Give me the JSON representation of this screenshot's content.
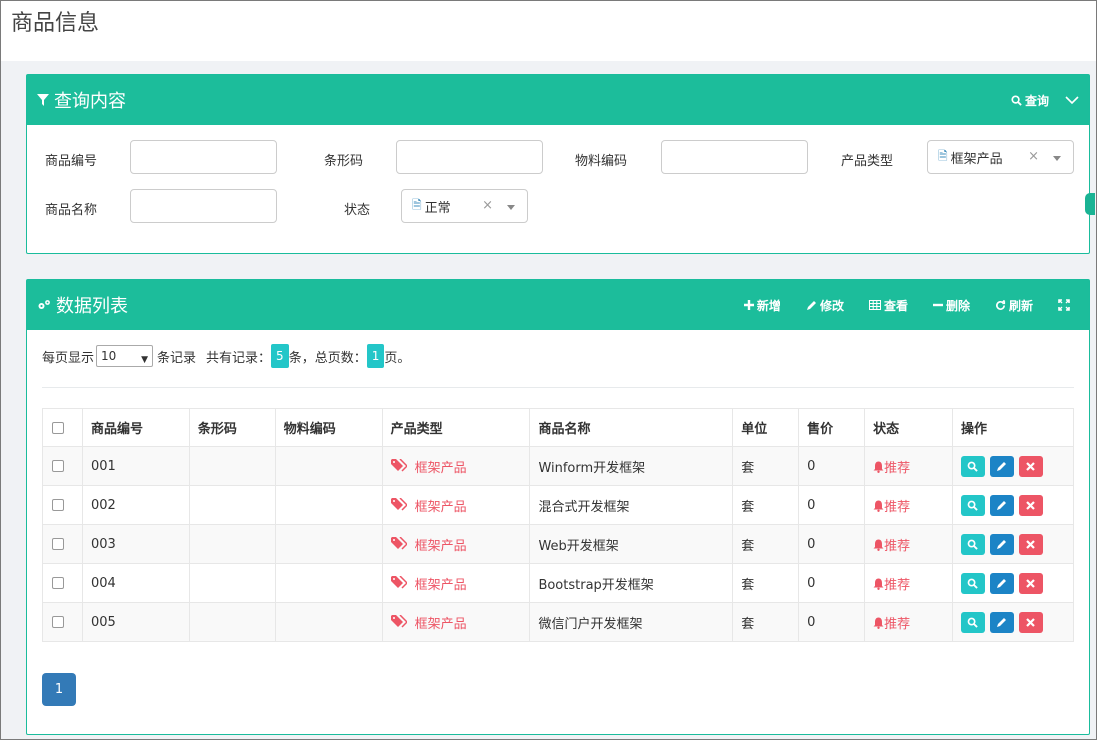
{
  "page": {
    "title": "商品信息"
  },
  "query": {
    "title": "查询内容",
    "search_label": "查询",
    "fields": {
      "product_code": "商品编号",
      "barcode": "条形码",
      "material_code": "物料编码",
      "product_type": "产品类型",
      "product_name": "商品名称",
      "status": "状态"
    },
    "product_type_value": "框架产品",
    "status_value": "正常",
    "clear_glyph": "×"
  },
  "datalist": {
    "title": "数据列表",
    "toolbar": {
      "add": "新增",
      "edit": "修改",
      "view": "查看",
      "delete": "删除",
      "refresh": "刷新"
    },
    "pager": {
      "per_page_prefix": "每页显示",
      "page_size": "10",
      "records_suffix": "条记录",
      "total_prefix": "共有记录：",
      "total": "5",
      "total_suffix": "条，总页数：",
      "pages": "1",
      "pages_suffix": "页。",
      "current_page": "1"
    },
    "columns": [
      "商品编号",
      "条形码",
      "物料编码",
      "产品类型",
      "商品名称",
      "单位",
      "售价",
      "状态",
      "操作"
    ],
    "rows": [
      {
        "code": "001",
        "barcode": "",
        "material": "",
        "type": "框架产品",
        "name": "Winform开发框架",
        "unit": "套",
        "price": "0",
        "status": "推荐"
      },
      {
        "code": "002",
        "barcode": "",
        "material": "",
        "type": "框架产品",
        "name": "混合式开发框架",
        "unit": "套",
        "price": "0",
        "status": "推荐"
      },
      {
        "code": "003",
        "barcode": "",
        "material": "",
        "type": "框架产品",
        "name": "Web开发框架",
        "unit": "套",
        "price": "0",
        "status": "推荐"
      },
      {
        "code": "004",
        "barcode": "",
        "material": "",
        "type": "框架产品",
        "name": "Bootstrap开发框架",
        "unit": "套",
        "price": "0",
        "status": "推荐"
      },
      {
        "code": "005",
        "barcode": "",
        "material": "",
        "type": "框架产品",
        "name": "微信门户开发框架",
        "unit": "套",
        "price": "0",
        "status": "推荐"
      }
    ]
  },
  "colors": {
    "header_green": "#1cbd9b",
    "accent_red": "#ed5565",
    "accent_cyan": "#23c6c8",
    "accent_blue": "#1c84c6",
    "page_blue": "#337ab7"
  }
}
